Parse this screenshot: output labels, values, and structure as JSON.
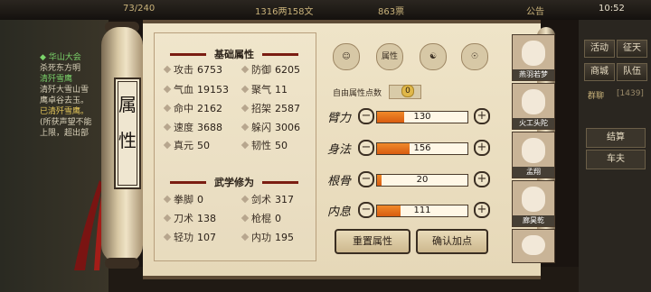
{
  "topbar": {
    "t1": "73/240",
    "t2": "1316两158文",
    "t3": "863票",
    "t4": "公告",
    "time": "10:52"
  },
  "quest": {
    "h1": "◆ 华山大会",
    "l1": "杀死东方明",
    "h2": "清歼雪鹰",
    "l2": "清歼大雪山雪",
    "l3": "鹰卓谷去玉。",
    "y1": "已清歼雪鹰。",
    "l4": "(所获声望不能",
    "l5": "上限，超出部"
  },
  "right_buttons": [
    "活动",
    "征天",
    "商城",
    "队伍"
  ],
  "right_small": "群聊",
  "right_count": "[1439]",
  "right_side": [
    "结算",
    "车夫"
  ],
  "scroll_title": "属性",
  "basic": {
    "title": "基础属性",
    "stats": [
      {
        "label": "攻击",
        "value": "6753"
      },
      {
        "label": "防御",
        "value": "6205"
      },
      {
        "label": "气血",
        "value": "19153"
      },
      {
        "label": "聚气",
        "value": "11"
      },
      {
        "label": "命中",
        "value": "2162"
      },
      {
        "label": "招架",
        "value": "2587"
      },
      {
        "label": "速度",
        "value": "3688"
      },
      {
        "label": "躲闪",
        "value": "3006"
      },
      {
        "label": "真元",
        "value": "50"
      },
      {
        "label": "韧性",
        "value": "50"
      }
    ]
  },
  "martial": {
    "title": "武学修为",
    "stats": [
      {
        "label": "拳脚",
        "value": "0"
      },
      {
        "label": "剑术",
        "value": "317"
      },
      {
        "label": "刀术",
        "value": "138"
      },
      {
        "label": "枪棍",
        "value": "0"
      },
      {
        "label": "轻功",
        "value": "107"
      },
      {
        "label": "内功",
        "value": "195"
      }
    ]
  },
  "tabs": [
    "",
    "属性",
    "",
    ""
  ],
  "free_points": {
    "label": "自由属性点数",
    "value": "0"
  },
  "attributes": [
    {
      "label": "臂力",
      "value": "130",
      "fill": 0.3
    },
    {
      "label": "身法",
      "value": "156",
      "fill": 0.36
    },
    {
      "label": "根骨",
      "value": "20",
      "fill": 0.05
    },
    {
      "label": "内息",
      "value": "111",
      "fill": 0.26
    }
  ],
  "buttons": {
    "reset": "重置属性",
    "confirm": "确认加点"
  },
  "characters": [
    "燕羽若梦",
    "火工头陀",
    "孟翔",
    "廊昊乾",
    ""
  ],
  "colors": {
    "fill": "#e8701e",
    "accent": "#7a1d12"
  }
}
